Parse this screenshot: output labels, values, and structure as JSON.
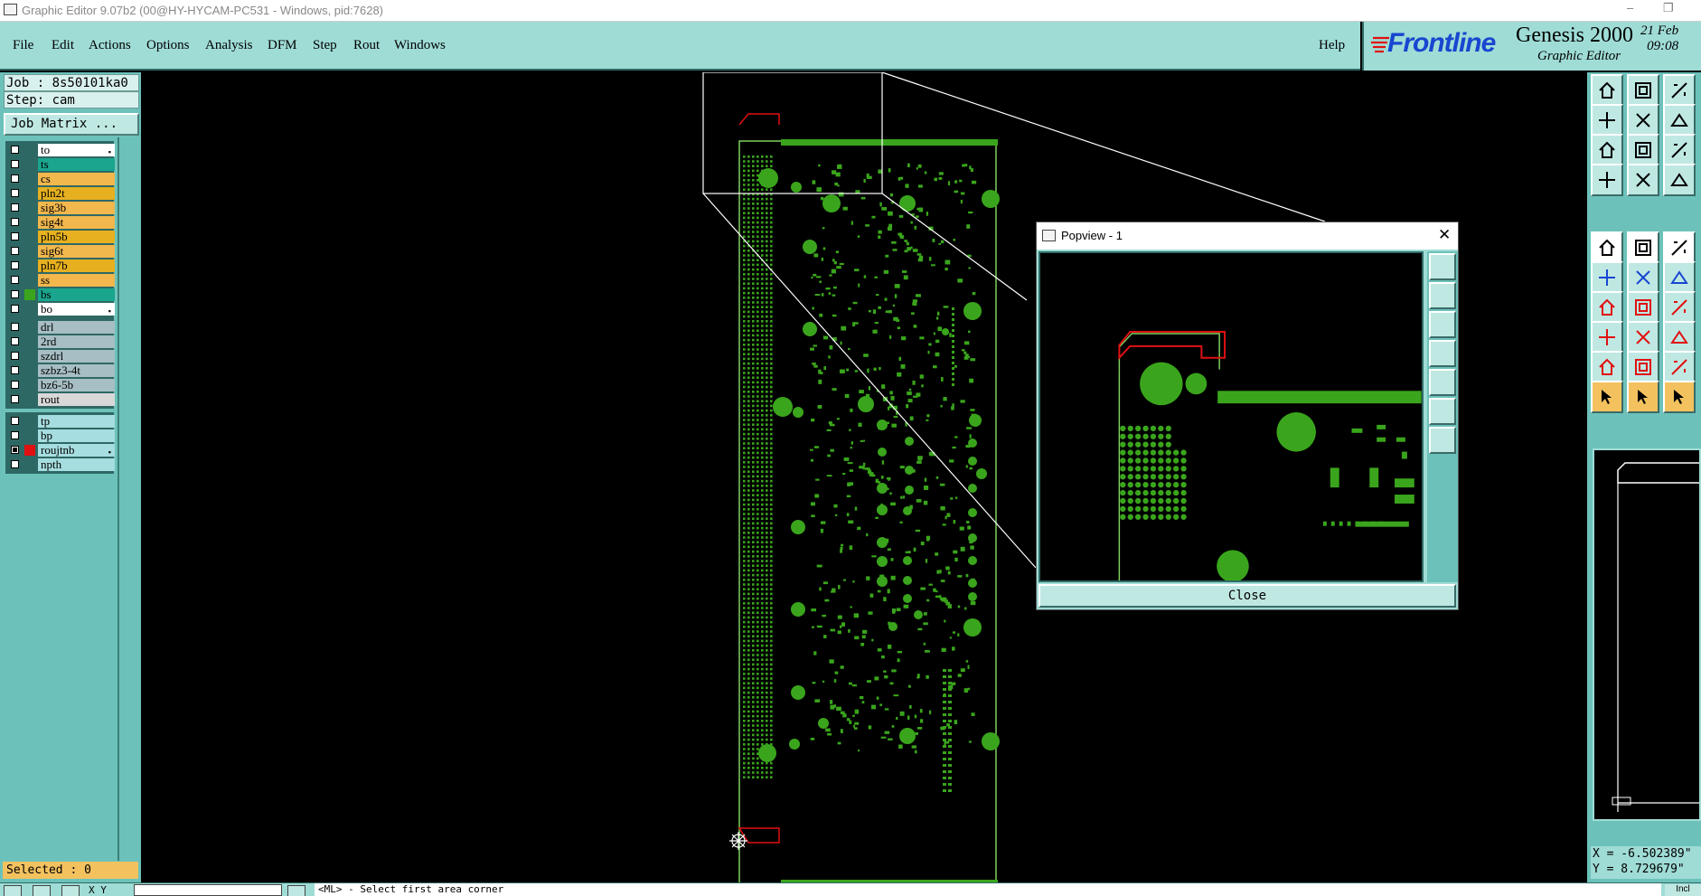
{
  "window": {
    "title": "Graphic Editor 9.07b2 (00@HY-HYCAM-PC531 - Windows, pid:7628)",
    "minimize_glyph": "–",
    "restore_glyph": "❐"
  },
  "menu": {
    "items": [
      "File",
      "Edit",
      "Actions",
      "Options",
      "Analysis",
      "DFM",
      "Step",
      "Rout",
      "Windows"
    ],
    "help": "Help"
  },
  "brand": {
    "logo_text": "Frontline",
    "product": "Genesis 2000",
    "subtitle": "Graphic Editor",
    "date": "21 Feb",
    "time": "09:08",
    "logo_color": "#1846d0"
  },
  "job": {
    "job_line": "Job : 8s50101ka0",
    "step_line": "Step: cam",
    "matrix_button": "Job Matrix ..."
  },
  "layer_groups": [
    [
      {
        "name": "to",
        "color": "#ffffff",
        "swatch": "",
        "checked": false,
        "workstate": true
      },
      {
        "name": "ts",
        "color": "#19a58e",
        "swatch": "",
        "checked": false,
        "workstate": false
      },
      {
        "name": "cs",
        "color": "#f2b74d",
        "swatch": "",
        "checked": false,
        "workstate": false
      },
      {
        "name": "pln2t",
        "color": "#e6b020",
        "swatch": "",
        "checked": false,
        "workstate": false
      },
      {
        "name": "sig3b",
        "color": "#f2b74d",
        "swatch": "",
        "checked": false,
        "workstate": false
      },
      {
        "name": "sig4t",
        "color": "#f2b74d",
        "swatch": "",
        "checked": false,
        "workstate": false
      },
      {
        "name": "pln5b",
        "color": "#e6b020",
        "swatch": "",
        "checked": false,
        "workstate": false
      },
      {
        "name": "sig6t",
        "color": "#f2b74d",
        "swatch": "",
        "checked": false,
        "workstate": false
      },
      {
        "name": "pln7b",
        "color": "#e6b020",
        "swatch": "",
        "checked": false,
        "workstate": false
      },
      {
        "name": "ss",
        "color": "#f2b74d",
        "swatch": "",
        "checked": false,
        "workstate": false
      },
      {
        "name": "bs",
        "color": "#19a58e",
        "swatch": "#3aa51c",
        "checked": false,
        "workstate": false
      },
      {
        "name": "bo",
        "color": "#ffffff",
        "swatch": "",
        "checked": false,
        "workstate": true
      }
    ],
    [
      {
        "name": "drl",
        "color": "#a7bec4",
        "swatch": "",
        "checked": false,
        "workstate": false
      },
      {
        "name": "2rd",
        "color": "#a7bec4",
        "swatch": "",
        "checked": false,
        "workstate": false
      },
      {
        "name": "szdrl",
        "color": "#a7bec4",
        "swatch": "",
        "checked": false,
        "workstate": false
      },
      {
        "name": "szbz3-4t",
        "color": "#a7bec4",
        "swatch": "",
        "checked": false,
        "workstate": false
      },
      {
        "name": "bz6-5b",
        "color": "#a7bec4",
        "swatch": "",
        "checked": false,
        "workstate": false
      },
      {
        "name": "rout",
        "color": "#d8d8d8",
        "swatch": "",
        "checked": false,
        "workstate": false
      }
    ],
    [
      {
        "name": "tp",
        "color": "#a6dde0",
        "swatch": "",
        "checked": false,
        "workstate": false
      },
      {
        "name": "bp",
        "color": "#a6dde0",
        "swatch": "",
        "checked": false,
        "workstate": false
      },
      {
        "name": "roujtnb",
        "color": "#a6dde0",
        "swatch": "#e01010",
        "checked": true,
        "workstate": true
      },
      {
        "name": "npth",
        "color": "#a6dde0",
        "swatch": "",
        "checked": false,
        "workstate": false
      }
    ]
  ],
  "selected": "Selected : 0",
  "coordinates": {
    "x": "X = -6.502389\"",
    "y": "Y = 8.729679\""
  },
  "status": {
    "xy_label": "X Y",
    "prompt": "<ML> - Select first area corner",
    "right_button": "Incl"
  },
  "popview": {
    "title": "Popview - 1",
    "close_button": "Close",
    "close_glyph": "✕"
  },
  "colors": {
    "panel": "#9fdcd6",
    "pcb_green": "#3aa51c",
    "outline": "#7fcf5e",
    "highlight_red": "#e01010"
  }
}
